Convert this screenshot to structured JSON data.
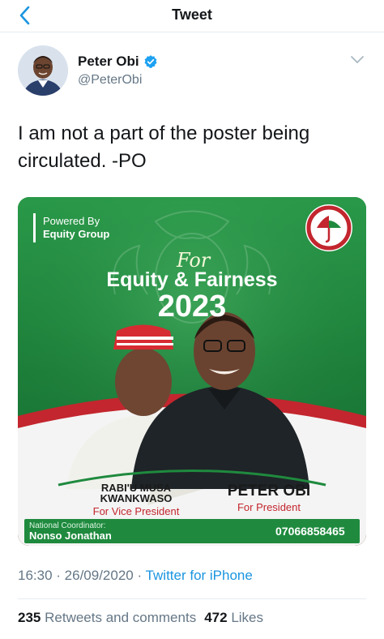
{
  "nav": {
    "title": "Tweet",
    "back_icon": "chevron-left-icon",
    "accent": "#1b95e0"
  },
  "author": {
    "name": "Peter Obi",
    "handle": "@PeterObi",
    "verified": true,
    "verified_color": "#1da1f2"
  },
  "tweet": {
    "text": "I am not a part of the poster being circulated. -PO"
  },
  "poster": {
    "powered_by": "Powered By",
    "powered_org": "Equity Group",
    "script_for": "For",
    "slogan": "Equity & Fairness",
    "year": "2023",
    "vice_name_1": "RABI'U MUSA",
    "vice_name_2": "KWANKWASO",
    "vice_role": "For Vice President",
    "pres_name": "PETER OBI",
    "pres_role": "For President",
    "coordinator_label": "National Coordinator:",
    "coordinator_name": "Nonso Jonathan",
    "phone": "07066858465",
    "colors": {
      "green": "#1f8a3e",
      "red": "#c3262e"
    }
  },
  "meta": {
    "time": "16:30",
    "separator": " · ",
    "date": "26/09/2020",
    "source": "Twitter for iPhone"
  },
  "stats": {
    "retweets_count": "235",
    "retweets_label": "Retweets and comments",
    "likes_count": "472",
    "likes_label": "Likes"
  }
}
